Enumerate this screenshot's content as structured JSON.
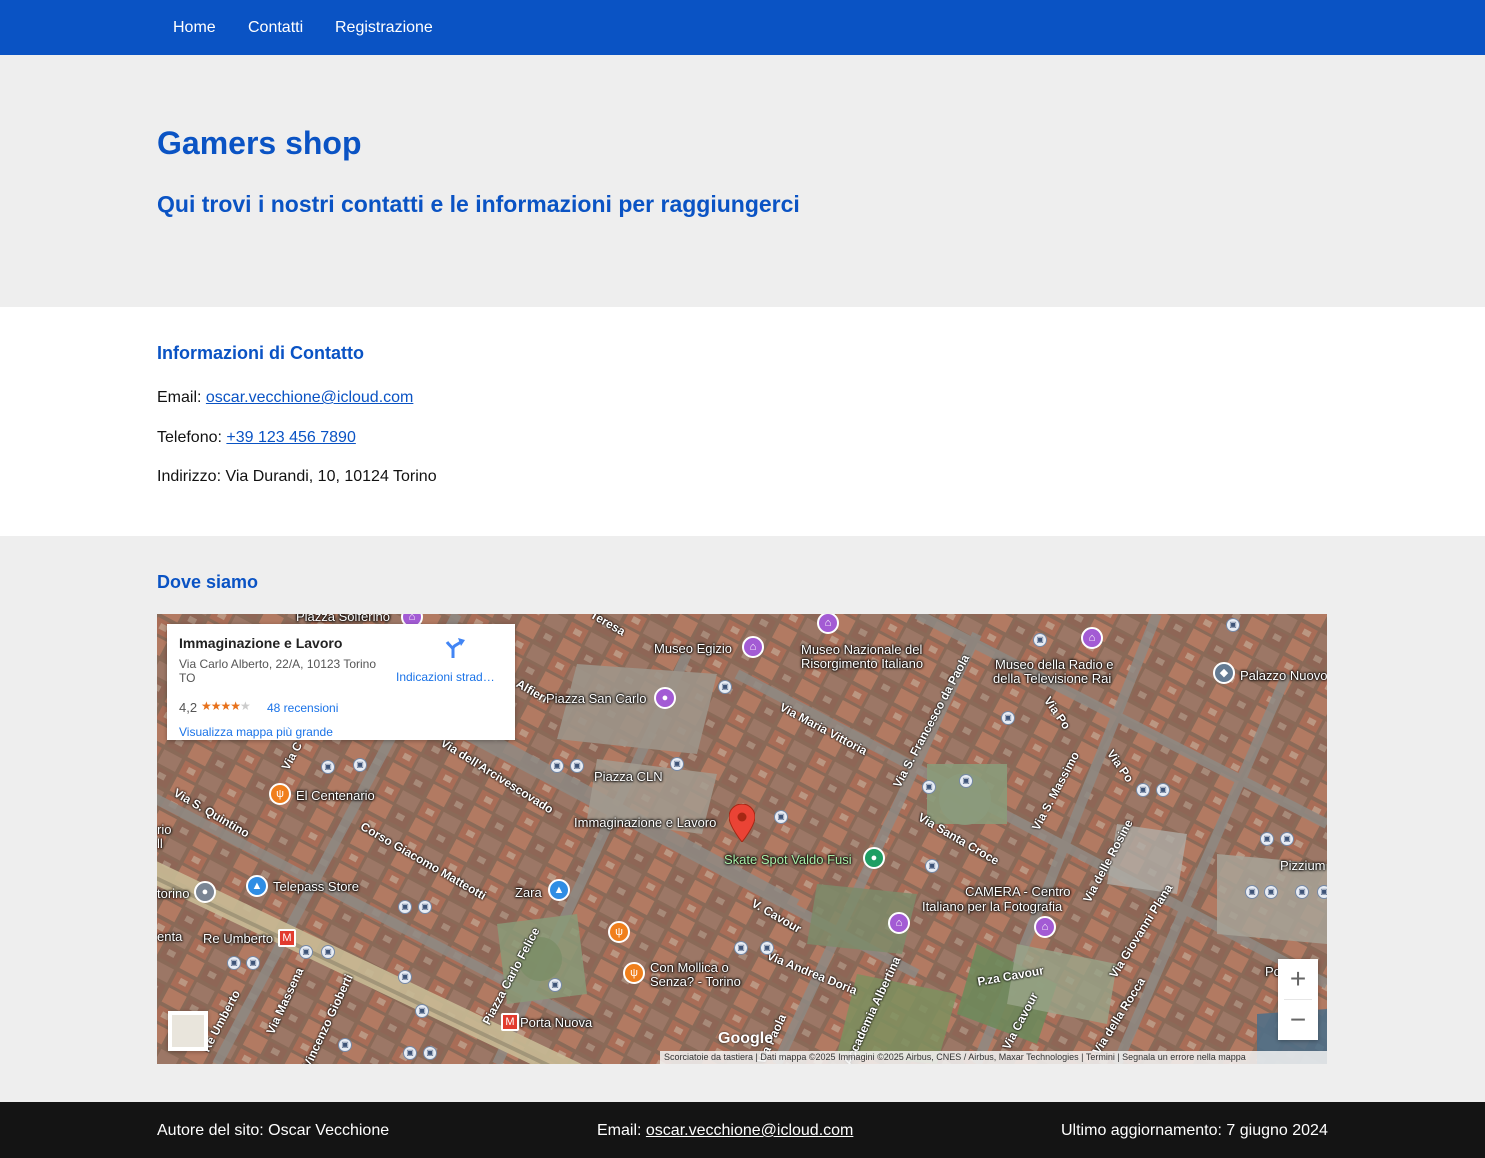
{
  "nav": {
    "items": [
      {
        "label": "Home"
      },
      {
        "label": "Contatti"
      },
      {
        "label": "Registrazione"
      }
    ]
  },
  "hero": {
    "title": "Gamers shop",
    "subtitle": "Qui trovi i nostri contatti e le informazioni per raggiungerci"
  },
  "contact": {
    "heading": "Informazioni di Contatto",
    "email_label": "Email: ",
    "email": "oscar.vecchione@icloud.com",
    "phone_label": "Telefono: ",
    "phone": "+39 123 456 7890",
    "address_label": "Indirizzo: ",
    "address": "Via Durandi, 10, 10124 Torino"
  },
  "location": {
    "heading": "Dove siamo",
    "map": {
      "card": {
        "name": "Immaginazione e Lavoro",
        "address": "Via Carlo Alberto, 22/A, 10123 Torino TO",
        "rating": "4,2",
        "rating_value": 4.2,
        "stars": "★★★★",
        "star_empty": "★",
        "reviews": "48 recensioni",
        "directions": "Indicazioni strad…",
        "larger_map": "Visualizza mappa più grande"
      },
      "labels": {
        "piazza_solferino": "Piazza Solferino",
        "museo_egizio": "Museo Egizio",
        "museo_risorgimento_1": "Museo Nazionale del",
        "museo_risorgimento_2": "Risorgimento Italiano",
        "museo_radio_1": "Museo della Radio e",
        "museo_radio_2": "della Televisione Rai",
        "palazzo_nuovo": "Palazzo Nuovo",
        "piazza_san_carlo": "Piazza San Carlo",
        "piazza_cln": "Piazza CLN",
        "el_centenario": "El Centenario",
        "immaginazione": "Immaginazione e Lavoro",
        "skate_spot": "Skate Spot Valdo Fusi",
        "telepass": "Telepass Store",
        "zara": "Zara",
        "torino": "torino",
        "re_umberto": "Re Umberto",
        "camera_1": "CAMERA - Centro",
        "camera_2": "Italiano per la Fotografia",
        "con_mollica_1": "Con Mollica o",
        "con_mollica_2": "Senza? - Torino",
        "porta_nuova": "Porta Nuova",
        "pizzium": "Pizzium",
        "p_za_cavour": "P.za Cavour",
        "rio": "rio",
        "ll": "ll",
        "enta": "enta",
        "po": "Po",
        "ttl": "tt"
      },
      "streets": {
        "via_maria_vittoria": "Via Maria Vittoria",
        "via_arcivescovado": "Via dell'Arcivescovado",
        "via_s_quintino": "Via S. Quintino",
        "corso_matteotti": "Corso Giacomo Matteotti",
        "via_santa_croce": "Via Santa Croce",
        "via_cavour": "V. Cavour",
        "via_andrea_doria": "Via Andrea Doria",
        "via_francesco_da_paola": "Via S. Francesco da Paola",
        "via_s_massimo": "Via S. Massimo",
        "via_po": "Via Po",
        "via_delle_rosine": "Via delle Rosine",
        "via_giovanni_plana": "Via Giovanni Plana",
        "via_della_rocca": "Via della Rocca",
        "via_carlo_felice": "Piazza Carlo Felice",
        "via_massena": "Via Massena",
        "via_gioberti": "Vincenzo Gioberti",
        "via_accademia": "Accademia Albertina",
        "via_cavour_2": "Via Cavour",
        "via_paola": "Via Paola",
        "via_umberto": "Re Umberto",
        "via_alfieri": "Alfieri",
        "via_teresa": "Teresa",
        "via_c": "Via C"
      },
      "zoom_in": "+",
      "zoom_out": "−",
      "google": "Google",
      "attribution": "Scorciatoie da tastiera  |  Dati mappa ©2025 Immagini ©2025 Airbus, CNES / Airbus, Maxar Technologies  |  Termini  |  Segnala un errore nella mappa"
    }
  },
  "footer": {
    "author": "Autore del sito: Oscar Vecchione",
    "email_label": "Email: ",
    "email": "oscar.vecchione@icloud.com",
    "updated": "Ultimo aggiornamento: 7 giugno 2024"
  },
  "colors": {
    "brand_blue": "#0a53c4",
    "footer_bg": "#141414",
    "section_grey": "#eeeeee",
    "pin_red": "#ea4335",
    "poi_purple": "#a35bd4",
    "poi_orange": "#f07f1c",
    "poi_blue": "#2f8de4",
    "poi_green": "#1e9e63"
  },
  "icons": {
    "map_pin": "map-pin-icon",
    "directions": "directions-icon",
    "museum": "museum-icon",
    "restaurant": "restaurant-icon",
    "shopping": "shopping-icon",
    "park": "park-icon",
    "bus": "bus-stop-icon",
    "metro": "metro-icon",
    "camera": "camera-icon",
    "university": "university-icon"
  }
}
